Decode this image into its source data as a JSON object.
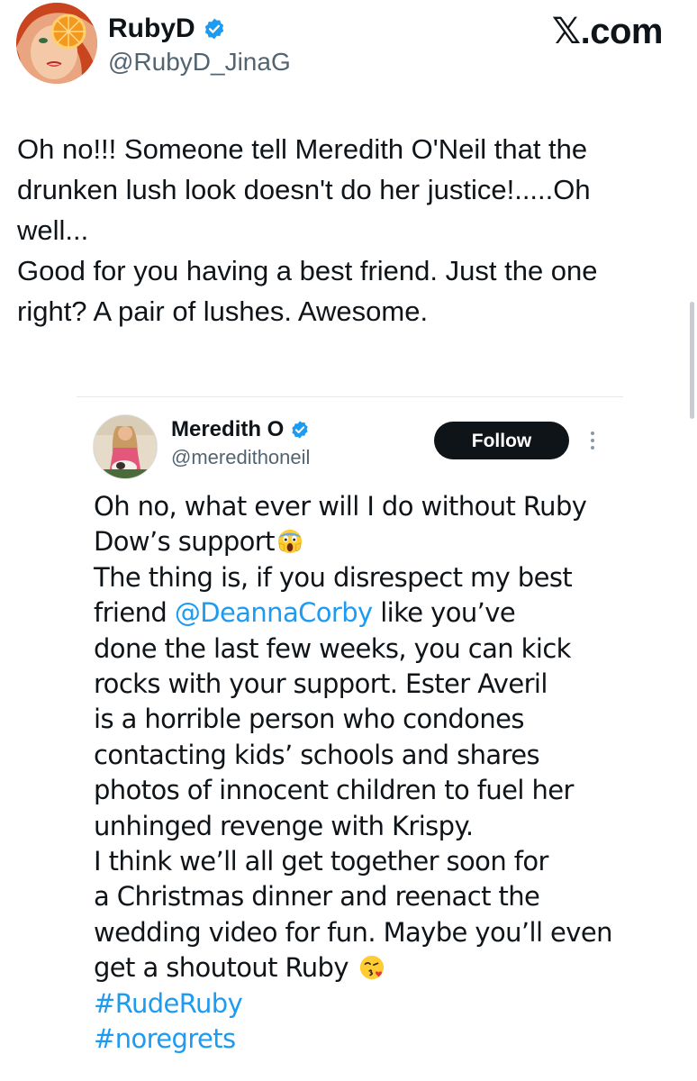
{
  "brand": {
    "name": "X.com",
    "glyph": "𝕏",
    "suffix": ".com"
  },
  "main_tweet": {
    "author_name": "RubyD",
    "author_handle": "@RubyD_JinaG",
    "verified": true,
    "text_lines": [
      "Oh no!!! Someone tell Meredith O'Neil that the",
      "drunken lush look doesn't do her justice!.....Oh",
      "well...",
      "Good for you having a best friend. Just the one",
      "right? A pair of lushes. Awesome."
    ]
  },
  "quoted_tweet": {
    "author_name": "Meredith O",
    "author_handle": "@meredithoneil",
    "verified": true,
    "follow_label": "Follow",
    "line_1": "Oh no, what ever will I do without Ruby",
    "line_2": "Dow’s support",
    "line_2_emoji": "face-screaming-in-fear-emoji",
    "line_3": "The thing is, if you disrespect my best",
    "line_4_pre": "friend ",
    "mention": "@DeannaCorby",
    "line_4_post": " like you’ve",
    "line_5": "done the last few weeks, you can kick",
    "line_6": "rocks with your support. Ester Averil",
    "line_7": "is a horrible person who condones",
    "line_8": "contacting kids’ schools and shares",
    "line_9": "photos of innocent children to fuel her",
    "line_10": "unhinged revenge with Krispy.",
    "line_11": "I think we’ll all get together soon for",
    "line_12": "a Christmas dinner and reenact the",
    "line_13": "wedding video for fun. Maybe you’ll even",
    "line_14": "get a shoutout Ruby ",
    "line_14_emoji": "face-blowing-a-kiss-emoji",
    "hashtag_1": "#RudeRuby",
    "hashtag_2": "#noregrets"
  },
  "colors": {
    "text": "#0f1419",
    "secondary": "#536471",
    "link": "#1d9bf0",
    "verified": "#1d9bf0",
    "follow_bg": "#0f1419",
    "follow_text": "#ffffff"
  }
}
